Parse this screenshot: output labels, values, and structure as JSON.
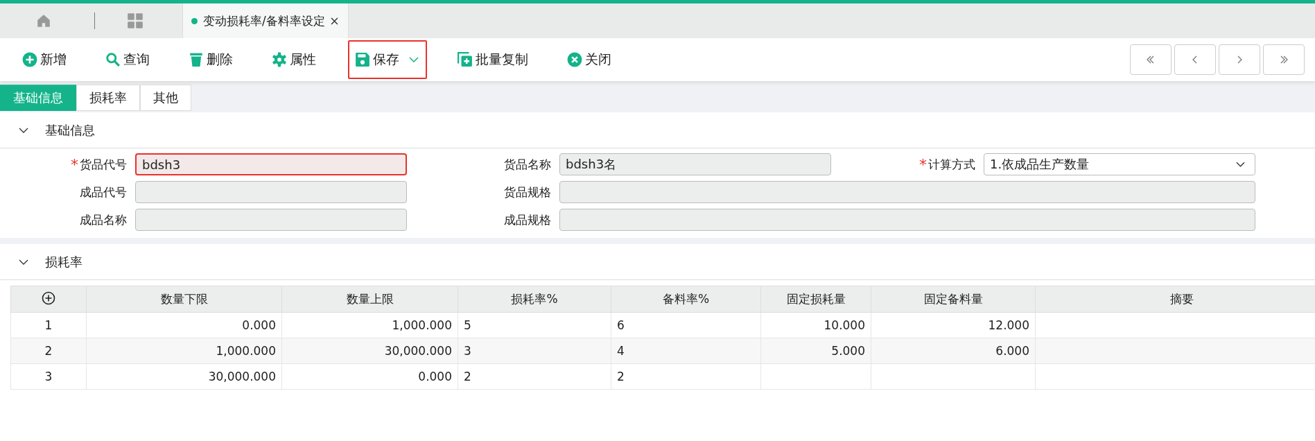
{
  "window_tab": {
    "title": "变动损耗率/备料率设定",
    "selected": true
  },
  "toolbar": [
    {
      "label": "新增",
      "highlighted": false
    },
    {
      "label": "查询",
      "highlighted": false
    },
    {
      "label": "删除",
      "highlighted": false
    },
    {
      "label": "属性",
      "highlighted": false
    },
    {
      "label": "保存",
      "highlighted": true
    },
    {
      "label": "批量复制",
      "highlighted": false
    },
    {
      "label": "关闭",
      "highlighted": false
    }
  ],
  "sub_tabs": [
    {
      "label": "基础信息",
      "selected": true
    },
    {
      "label": "损耗率",
      "selected": false
    },
    {
      "label": "其他",
      "selected": false
    }
  ],
  "basic_section": {
    "title": "基础信息",
    "expanded": true,
    "fields": [
      {
        "required_mark": "*",
        "label": "货品代号",
        "value": "bdsh3",
        "highlighted": true,
        "kind": "input"
      },
      {
        "label": "货品名称",
        "value": "bdsh3名",
        "highlighted": false,
        "kind": "input"
      },
      {
        "required_mark": "*",
        "label": "计算方式",
        "value": "1.依成品生产数量",
        "highlighted": false,
        "kind": "select"
      },
      {
        "label": "成品代号",
        "highlighted": false,
        "kind": "input"
      },
      {
        "label": "货品规格",
        "highlighted": false,
        "kind": "wide"
      },
      {
        "label": "成品名称",
        "highlighted": false,
        "kind": "input"
      },
      {
        "label": "成品规格",
        "highlighted": false,
        "kind": "wide"
      }
    ]
  },
  "loss_section": {
    "title": "损耗率",
    "expanded": true,
    "table": {
      "columns": [
        "",
        "数量下限",
        "数量上限",
        "损耗率%",
        "备料率%",
        "固定损耗量",
        "固定备料量",
        "摘要"
      ],
      "rows": [
        [
          "1",
          "0.000",
          "1,000.000",
          "5",
          "6",
          "10.000",
          "12.000",
          ""
        ],
        [
          "2",
          "1,000.000",
          "30,000.000",
          "3",
          "4",
          "5.000",
          "6.000",
          ""
        ],
        [
          "3",
          "30,000.000",
          "0.000",
          "2",
          "2",
          "",
          "",
          ""
        ]
      ]
    }
  }
}
